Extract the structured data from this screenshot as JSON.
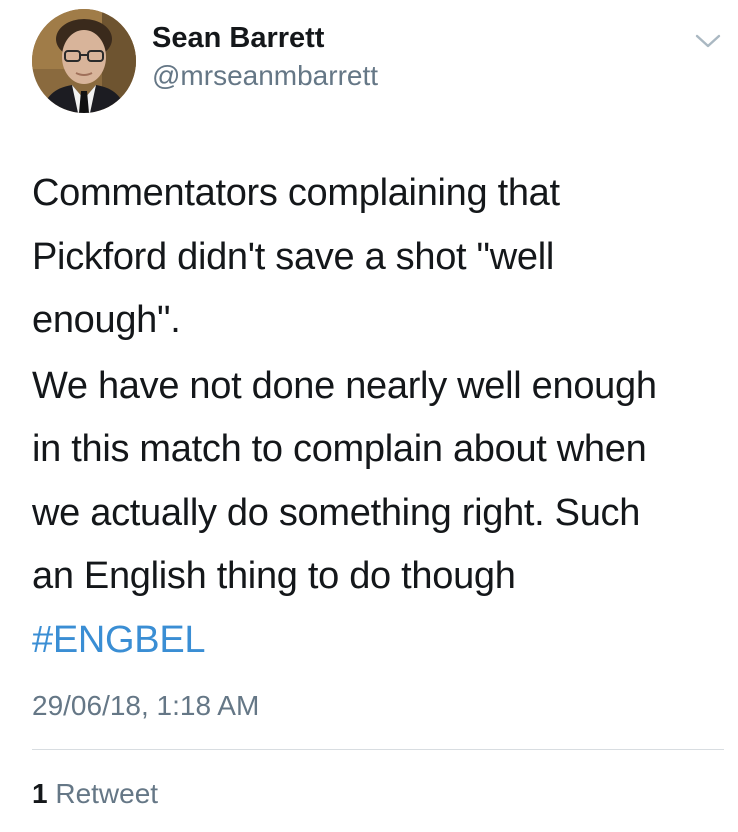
{
  "user": {
    "display_name": "Sean Barrett",
    "handle": "@mrseanmbarrett",
    "avatar_icon": "profile-photo"
  },
  "menu": {
    "icon": "chevron-down-icon"
  },
  "tweet": {
    "paragraph_1": "Commentators complaining that\nPickford didn't save a shot \"well\nenough\".",
    "paragraph_2": "We have not done nearly well enough\nin this match to complain about when\nwe actually do something right. Such\nan English thing to do though",
    "hashtag": "#ENGBEL",
    "timestamp": "29/06/18, 1:18 AM"
  },
  "stats": {
    "retweet_count": "1",
    "retweet_label": "Retweet"
  },
  "colors": {
    "text": "#14171a",
    "secondary": "#657786",
    "link": "#3a8ed4",
    "divider": "#d8dde1"
  }
}
